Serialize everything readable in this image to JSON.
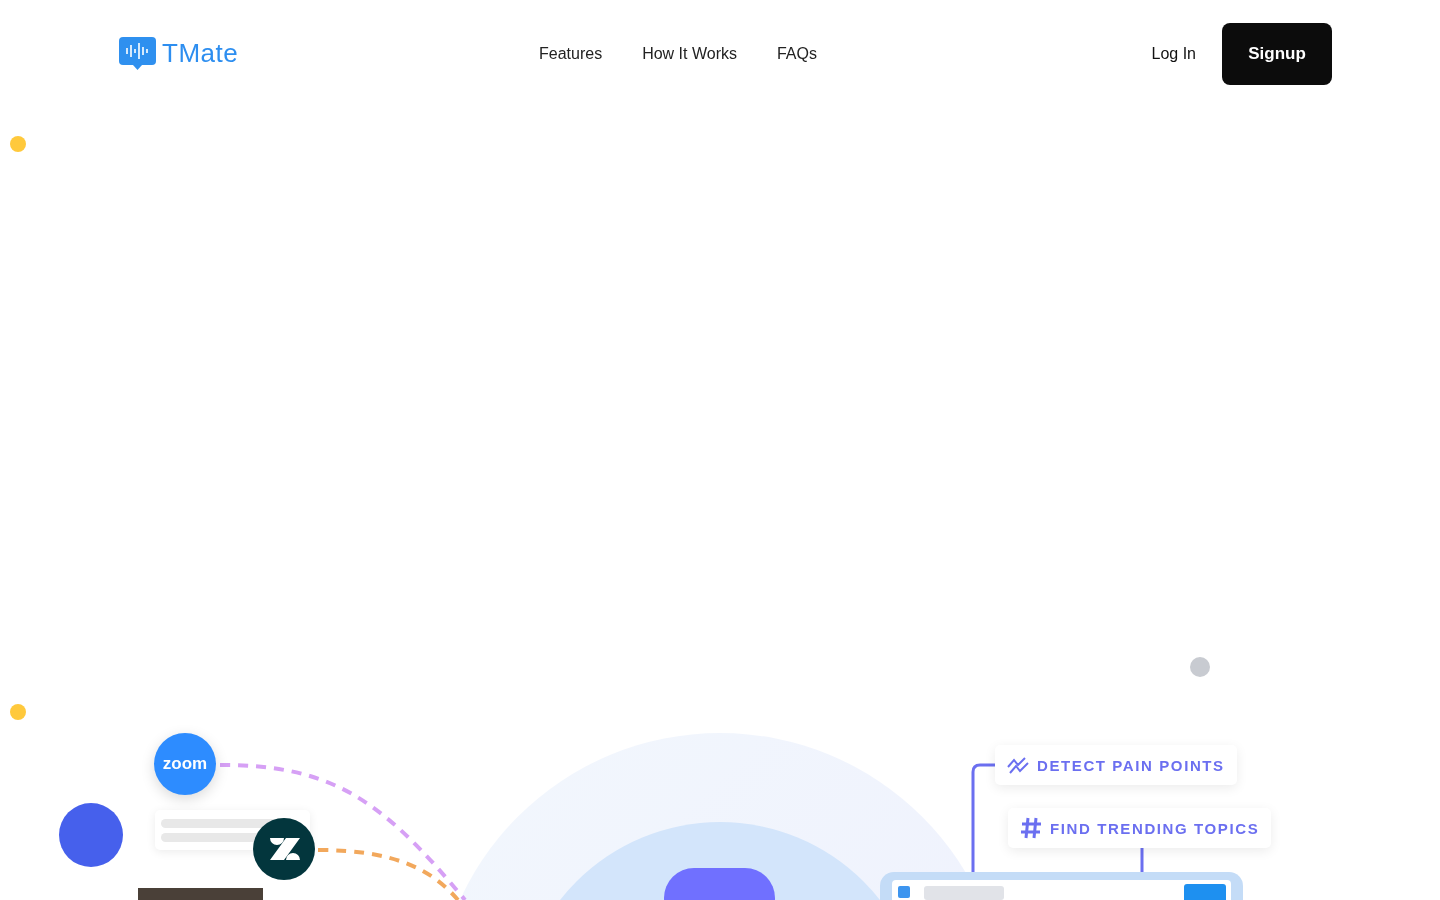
{
  "header": {
    "logo": "TMate",
    "nav": [
      "Features",
      "How It Works",
      "FAQs"
    ],
    "login": "Log In",
    "signup": "Signup"
  },
  "illustration": {
    "zoom_logo": "zoom",
    "tags": [
      {
        "kind": "trend",
        "label": "DETECT PAIN POINTS"
      },
      {
        "kind": "hash",
        "label": "FIND TRENDING TOPICS"
      }
    ]
  }
}
